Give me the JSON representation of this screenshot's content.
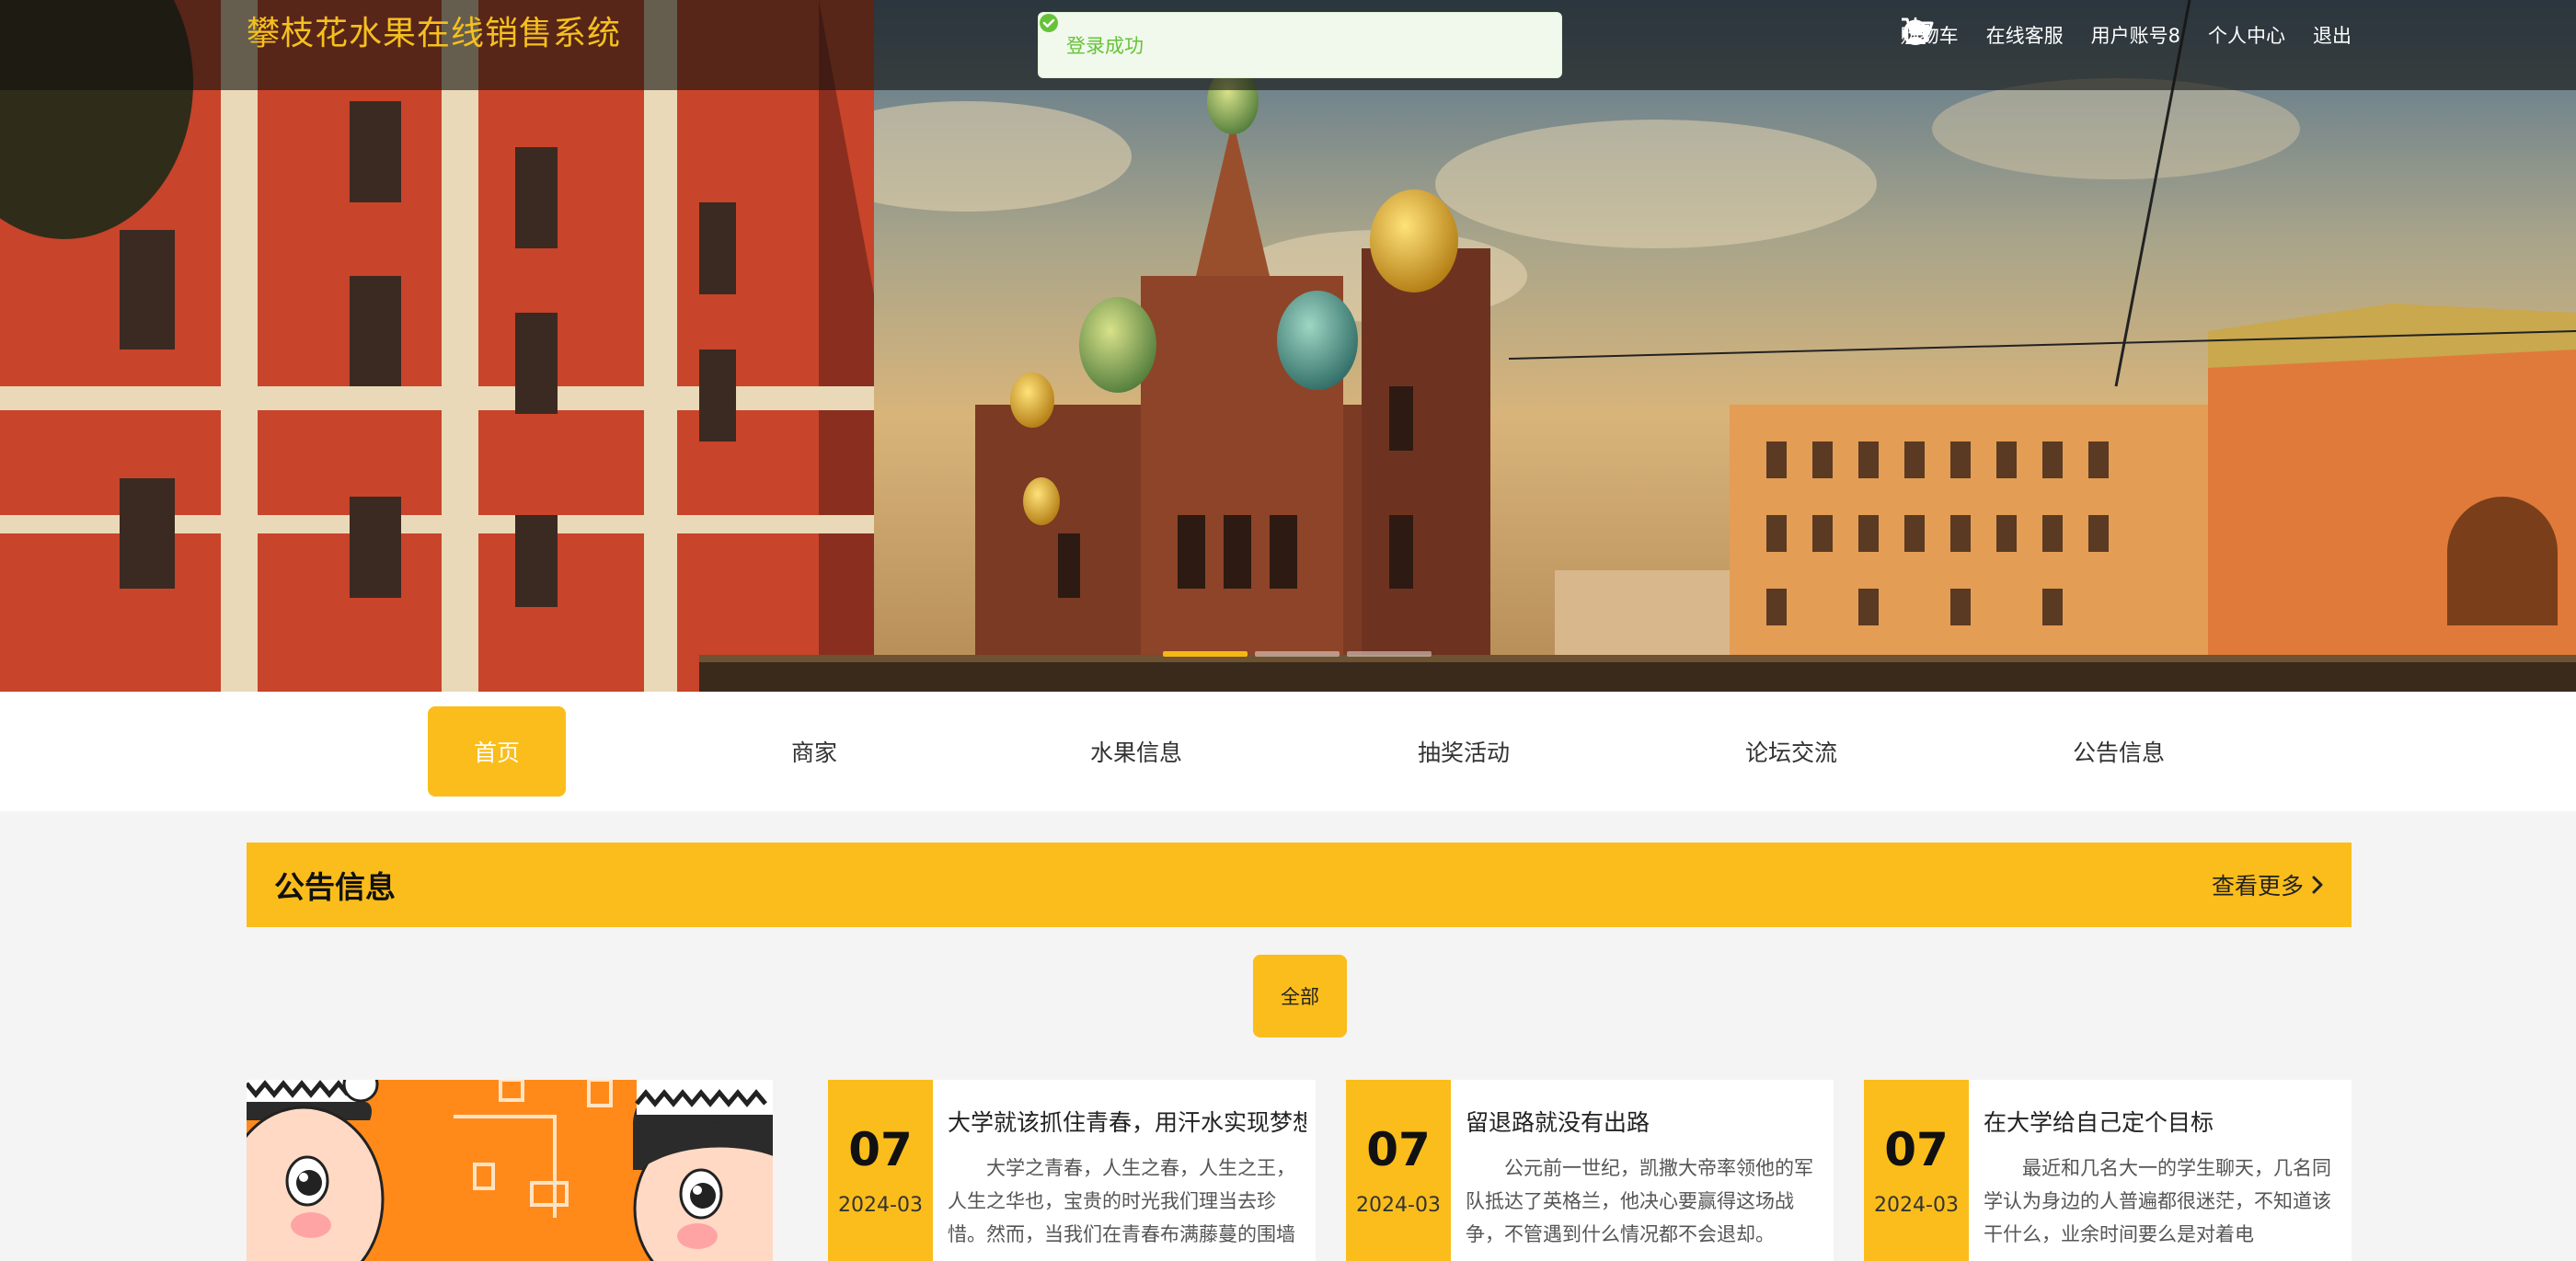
{
  "header": {
    "site_title": "攀枝花水果在线销售系统",
    "links": [
      {
        "label": "购物车",
        "icon": "cart-icon"
      },
      {
        "label": "在线客服",
        "icon": "headset-icon"
      },
      {
        "label": "用户账号8",
        "icon": ""
      },
      {
        "label": "个人中心",
        "icon": ""
      },
      {
        "label": "退出",
        "icon": "power-icon"
      }
    ]
  },
  "toast": {
    "message": "登录成功",
    "icon": "success-check-icon",
    "color": "#67c23a"
  },
  "banner": {
    "slides": 3,
    "active_slide": 1
  },
  "nav": {
    "items": [
      "首页",
      "商家",
      "水果信息",
      "抽奖活动",
      "论坛交流",
      "公告信息"
    ],
    "active": 0
  },
  "notice_section": {
    "title": "公告信息",
    "more_label": "查看更多",
    "filter_label": "全部",
    "cards": [
      {
        "day": "07",
        "year_month": "2024-03",
        "title": "大学就该抓住青春，用汗水实现梦想",
        "excerpt": "大学之青春，人生之春，人生之王，人生之华也，宝贵的时光我们理当去珍惜。然而，当我们在青春布满藤蔓的围墙"
      },
      {
        "day": "07",
        "year_month": "2024-03",
        "title": "留退路就没有出路",
        "excerpt": "公元前一世纪，凯撒大帝率领他的军队抵达了英格兰，他决心要赢得这场战争，不管遇到什么情况都不会退却。"
      },
      {
        "day": "07",
        "year_month": "2024-03",
        "title": "在大学给自己定个目标",
        "excerpt": "最近和几名大一的学生聊天，几名同学认为身边的人普遍都很迷茫，不知道该干什么，业余时间要么是对着电"
      }
    ]
  },
  "colors": {
    "accent": "#fbbd1b",
    "title": "#f5c01f",
    "success": "#67c23a"
  }
}
